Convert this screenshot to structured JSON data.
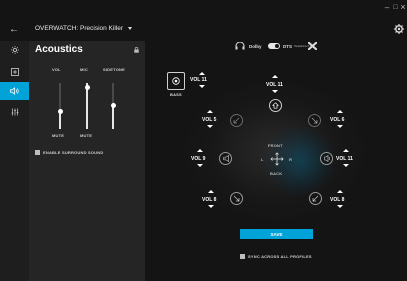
{
  "window": {
    "minimize": "–",
    "maximize": "□",
    "close": "×"
  },
  "header": {
    "profile_name": "OVERWATCH: Precision Killer",
    "back": "←"
  },
  "rail": {
    "items": [
      "lighting",
      "onboard-memory",
      "acoustics",
      "equalizer"
    ],
    "active_index": 2
  },
  "acoustics": {
    "title": "Acoustics",
    "sliders": [
      {
        "label": "VOL",
        "value_fraction": 0.35,
        "mute_label": "MUTE"
      },
      {
        "label": "MIC",
        "value_fraction": 0.95,
        "mute_label": "MUTE"
      },
      {
        "label": "SIDETONE",
        "value_fraction": 0.6,
        "mute_label": ""
      }
    ],
    "surround_checkbox": {
      "label": "ENABLE SURROUND SOUND",
      "checked": true
    }
  },
  "surround": {
    "brands": {
      "dolby": "Dolby",
      "dts": "DTS",
      "dts_sub": "Headphone:X"
    },
    "selected_mode": "dts",
    "bass": {
      "label": "BASS",
      "vol": "VOL 11"
    },
    "channels": {
      "center": "VOL 11",
      "front_left": "VOL 5",
      "front_right": "VOL 6",
      "left": "VOL 9",
      "right": "VOL 11",
      "rear_left": "VOL 8",
      "rear_right": "VOL 8"
    },
    "compass": {
      "front": "FRONT",
      "back": "BACK",
      "left": "L",
      "right": "R"
    },
    "save_label": "SAVE",
    "sync_checkbox": {
      "label": "SYNC ACROSS ALL PROFILES",
      "checked": true
    }
  },
  "colors": {
    "accent": "#00a3d8",
    "panel": "#252525",
    "background": "#141414"
  }
}
